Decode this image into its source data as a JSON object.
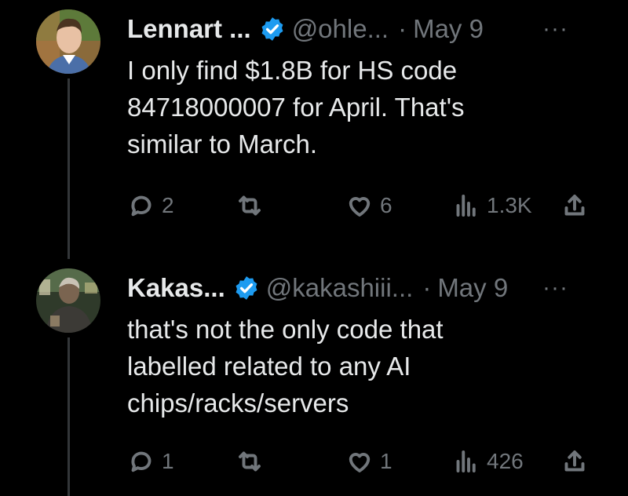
{
  "colors": {
    "background": "#000000",
    "text": "#e7e9ea",
    "muted": "#71767b",
    "verified": "#1d9bf0",
    "thread_line": "#333639"
  },
  "tweets": [
    {
      "name": "Lennart ...",
      "handle": "@ohle...",
      "separator": "·",
      "date": "May 9",
      "more": "···",
      "lines": [
        "I only find $1.8B for HS code",
        "84718000007 for April. That's",
        "similar to March."
      ],
      "replies": "2",
      "retweets": "",
      "likes": "6",
      "views": "1.3K",
      "avatar_icon": "avatar-photo-icon"
    },
    {
      "name": "Kakas...",
      "handle": "@kakashiii...",
      "separator": "·",
      "date": "May 9",
      "more": "···",
      "lines": [
        "that's not the only code that",
        "labelled related to any AI",
        "chips/racks/servers"
      ],
      "replies": "1",
      "retweets": "",
      "likes": "1",
      "views": "426",
      "avatar_icon": "avatar-photo-icon"
    }
  ]
}
